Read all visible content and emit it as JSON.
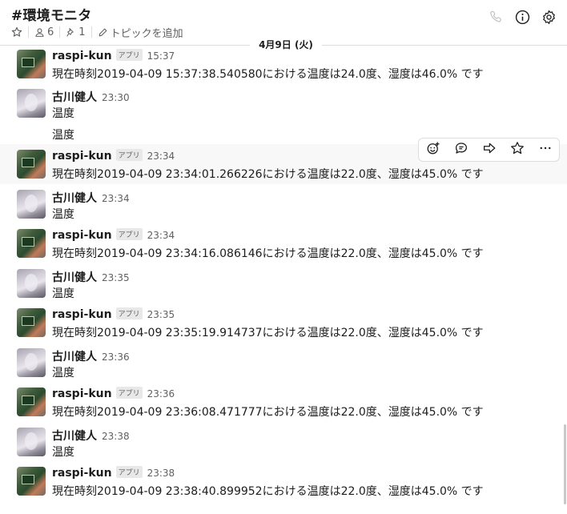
{
  "header": {
    "title": "#環境モニタ",
    "members_count": "6",
    "pins_count": "1",
    "add_topic": "トピックを追加",
    "icons": [
      "star-icon",
      "person-icon",
      "pin-icon",
      "pencil-icon",
      "phone-icon",
      "info-icon",
      "gear-icon"
    ]
  },
  "date_divider": "4月9日 (火)",
  "app_badge": "アプリ",
  "messages": [
    {
      "author": "raspi-kun",
      "app": true,
      "time": "15:37",
      "lines": [
        "現在時刻2019-04-09 15:37:38.540580における温度は24.0度、湿度は46.0% です"
      ]
    },
    {
      "author": "古川健人",
      "app": false,
      "time": "23:30",
      "lines": [
        "温度",
        "温度"
      ]
    },
    {
      "author": "raspi-kun",
      "app": true,
      "time": "23:34",
      "lines": [
        "現在時刻2019-04-09 23:34:01.266226における温度は22.0度、湿度は45.0% です"
      ]
    },
    {
      "author": "古川健人",
      "app": false,
      "time": "23:34",
      "lines": [
        "温度"
      ]
    },
    {
      "author": "raspi-kun",
      "app": true,
      "time": "23:34",
      "lines": [
        "現在時刻2019-04-09 23:34:16.086146における温度は22.0度、湿度は45.0% です"
      ]
    },
    {
      "author": "古川健人",
      "app": false,
      "time": "23:35",
      "lines": [
        "温度"
      ]
    },
    {
      "author": "raspi-kun",
      "app": true,
      "time": "23:35",
      "lines": [
        "現在時刻2019-04-09 23:35:19.914737における温度は22.0度、湿度は45.0% です"
      ]
    },
    {
      "author": "古川健人",
      "app": false,
      "time": "23:36",
      "lines": [
        "温度"
      ]
    },
    {
      "author": "raspi-kun",
      "app": true,
      "time": "23:36",
      "lines": [
        "現在時刻2019-04-09 23:36:08.471777における温度は22.0度、湿度は45.0% です"
      ]
    },
    {
      "author": "古川健人",
      "app": false,
      "time": "23:38",
      "lines": [
        "温度"
      ]
    },
    {
      "author": "raspi-kun",
      "app": true,
      "time": "23:38",
      "lines": [
        "現在時刻2019-04-09 23:38:40.899952における温度は22.0度、湿度は45.0% です"
      ]
    }
  ],
  "hover_toolbar": {
    "icons": [
      "add-reaction-icon",
      "reply-thread-icon",
      "share-icon",
      "save-star-icon",
      "more-actions-icon"
    ]
  }
}
